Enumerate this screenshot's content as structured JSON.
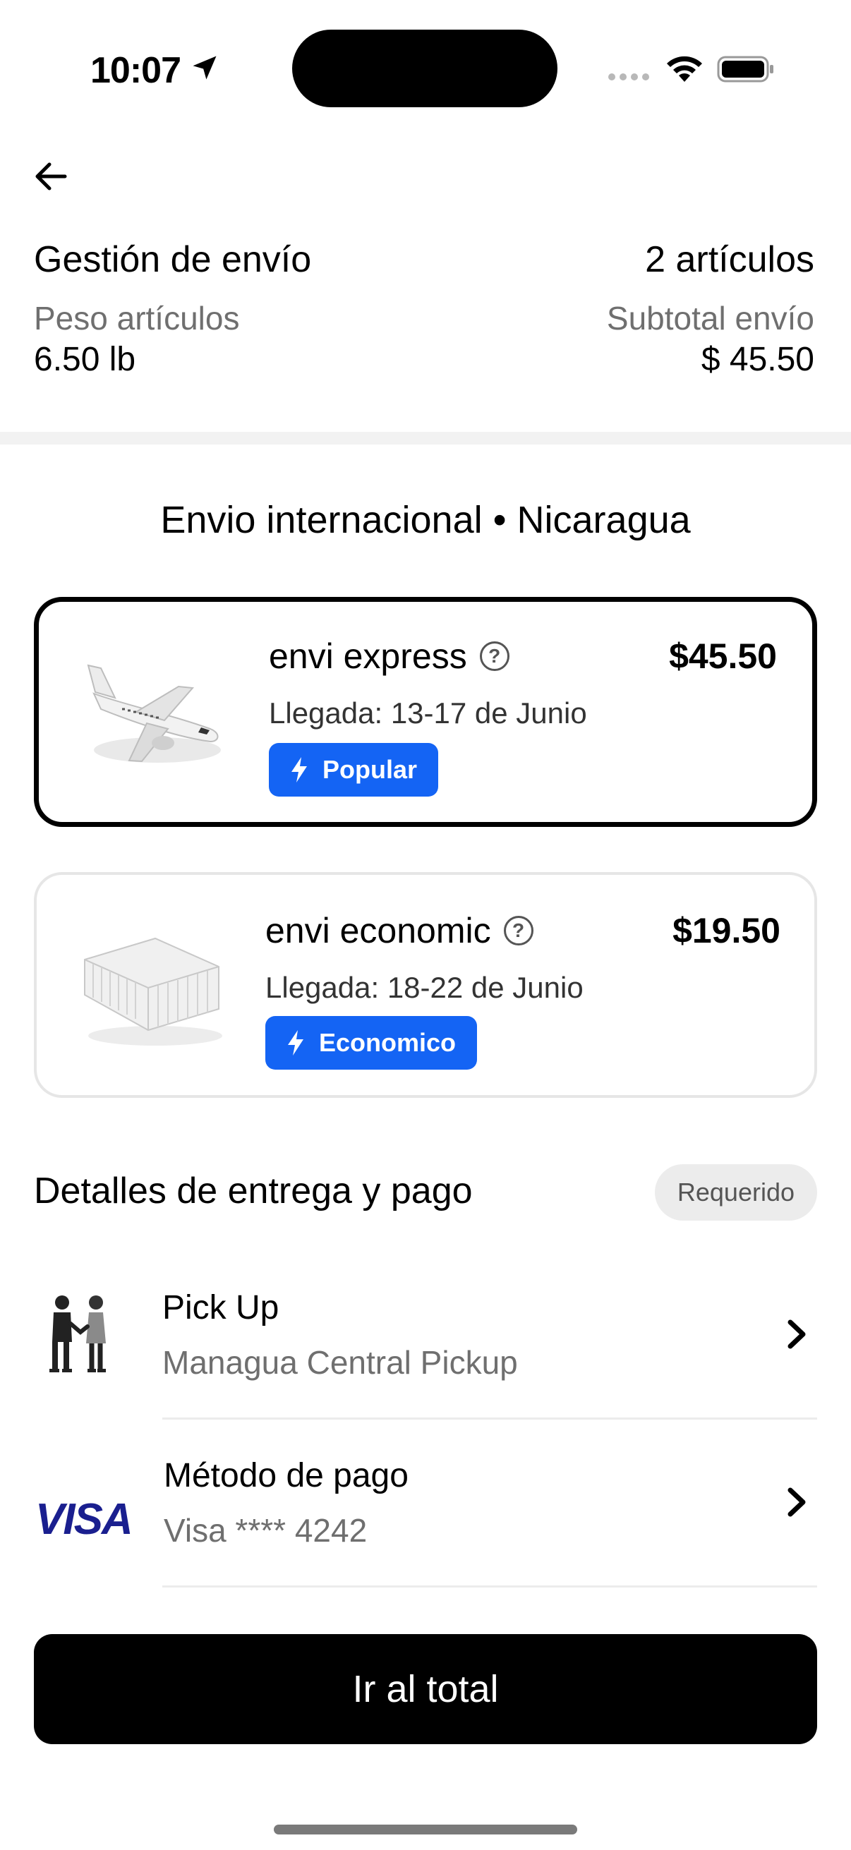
{
  "status_bar": {
    "time": "10:07"
  },
  "header": {
    "title": "Gestión de envío",
    "items_count": "2 artículos",
    "weight_label": "Peso artículos",
    "weight_value": "6.50 lb",
    "subtotal_label": "Subtotal envío",
    "subtotal_value": "$ 45.50"
  },
  "shipping": {
    "heading": "Envio internacional • Nicaragua",
    "options": [
      {
        "name": "envi express",
        "price": "$45.50",
        "eta": "Llegada: 13-17 de Junio",
        "badge": "Popular",
        "icon": "airplane-icon",
        "selected": true
      },
      {
        "name": "envi economic",
        "price": "$19.50",
        "eta": "Llegada: 18-22 de Junio",
        "badge": "Economico",
        "icon": "container-icon",
        "selected": false
      }
    ],
    "help_glyph": "?",
    "badge_color": "#1464f4"
  },
  "delivery_payment": {
    "title": "Detalles de entrega y pago",
    "required_badge": "Requerido",
    "pickup": {
      "title": "Pick Up",
      "subtitle": "Managua Central Pickup",
      "icon": "handshake-icon"
    },
    "payment": {
      "title": "Método de pago",
      "subtitle": "Visa **** 4242",
      "logo": "VISA"
    }
  },
  "cta": {
    "label": "Ir al total"
  }
}
